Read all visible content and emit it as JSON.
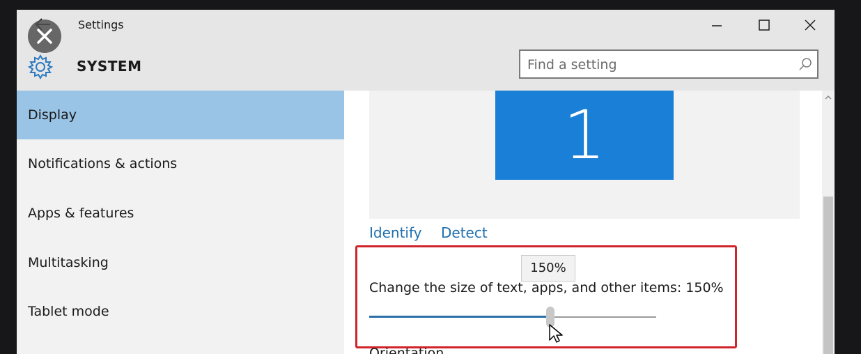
{
  "window": {
    "title": "Settings",
    "section": "SYSTEM"
  },
  "search": {
    "placeholder": "Find a setting",
    "value": ""
  },
  "sidebar": {
    "items": [
      {
        "label": "Display",
        "selected": true
      },
      {
        "label": "Notifications & actions",
        "selected": false
      },
      {
        "label": "Apps & features",
        "selected": false
      },
      {
        "label": "Multitasking",
        "selected": false
      },
      {
        "label": "Tablet mode",
        "selected": false
      }
    ]
  },
  "display": {
    "monitor_number": "1",
    "identify_label": "Identify",
    "detect_label": "Detect",
    "scale_tooltip": "150%",
    "scale_label": "Change the size of text, apps, and other items: 150%",
    "scale_slider_fraction": 0.63,
    "orientation_label": "Orientation"
  },
  "icons": {
    "back": "back-arrow-icon",
    "overlay_close": "close-icon",
    "minimize": "minimize-icon",
    "maximize": "maximize-icon",
    "close": "close-icon",
    "settings": "gear-icon",
    "search": "search-icon",
    "cursor": "mouse-pointer-icon"
  },
  "colors": {
    "selected_nav": "#99c4e6",
    "monitor": "#1a7fd6",
    "link": "#1f6fae",
    "highlight_box": "#d0242c",
    "slider_fill": "#2a6fa8"
  }
}
